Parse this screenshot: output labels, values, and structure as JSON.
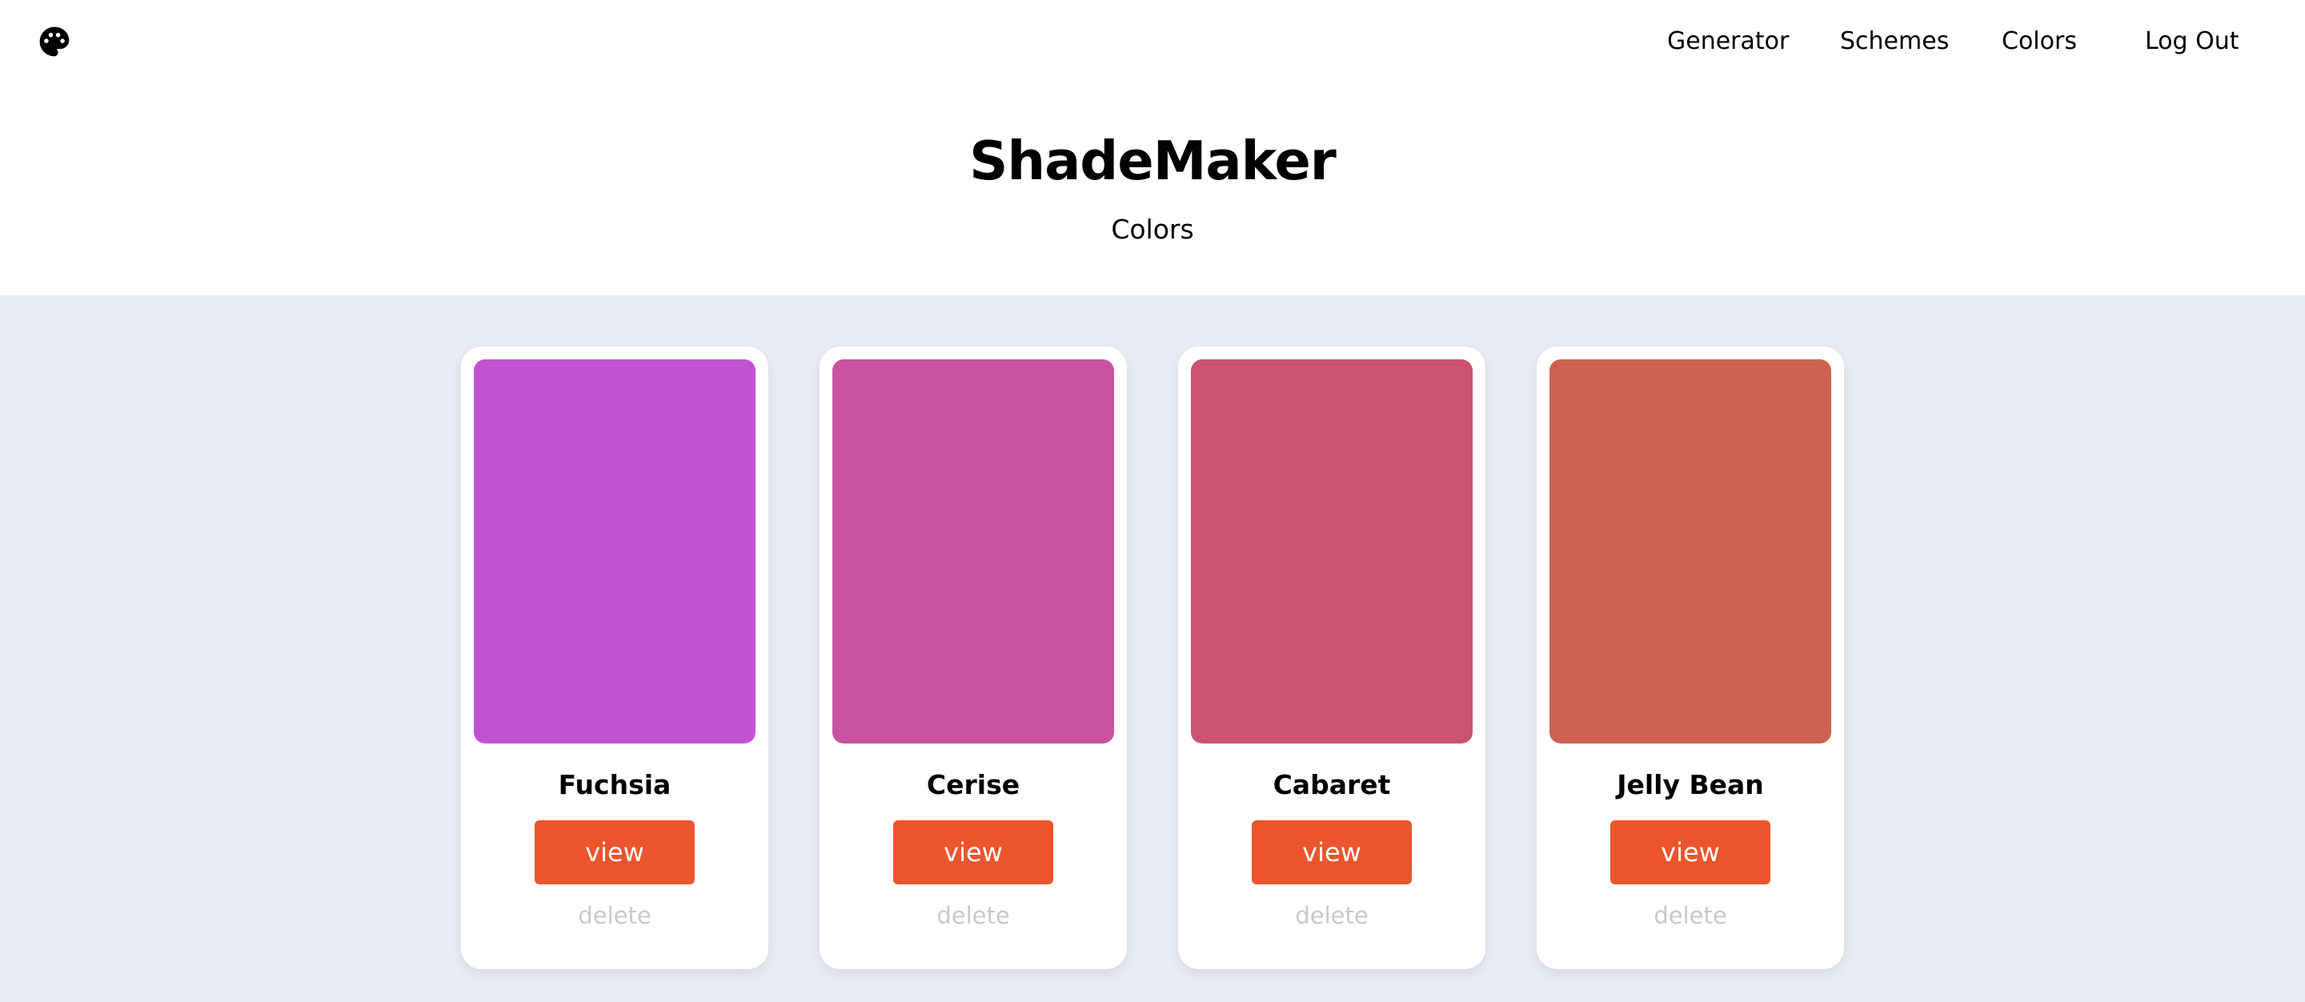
{
  "header": {
    "logo_icon": "palette-icon",
    "nav": {
      "generator": "Generator",
      "schemes": "Schemes",
      "colors": "Colors",
      "logout": "Log Out"
    }
  },
  "hero": {
    "title": "ShadeMaker",
    "subtitle": "Colors"
  },
  "theme": {
    "page_bg": "#e8ebf3",
    "button_color": "#eb552d",
    "delete_color": "#c7c9cc"
  },
  "cards": [
    {
      "name": "Fuchsia",
      "color": "#c153d1",
      "view_label": "view",
      "delete_label": "delete"
    },
    {
      "name": "Cerise",
      "color": "#c9539f",
      "view_label": "view",
      "delete_label": "delete"
    },
    {
      "name": "Cabaret",
      "color": "#ca536f",
      "view_label": "view",
      "delete_label": "delete"
    },
    {
      "name": "Jelly Bean",
      "color": "#cd6152",
      "view_label": "view",
      "delete_label": "delete"
    }
  ]
}
